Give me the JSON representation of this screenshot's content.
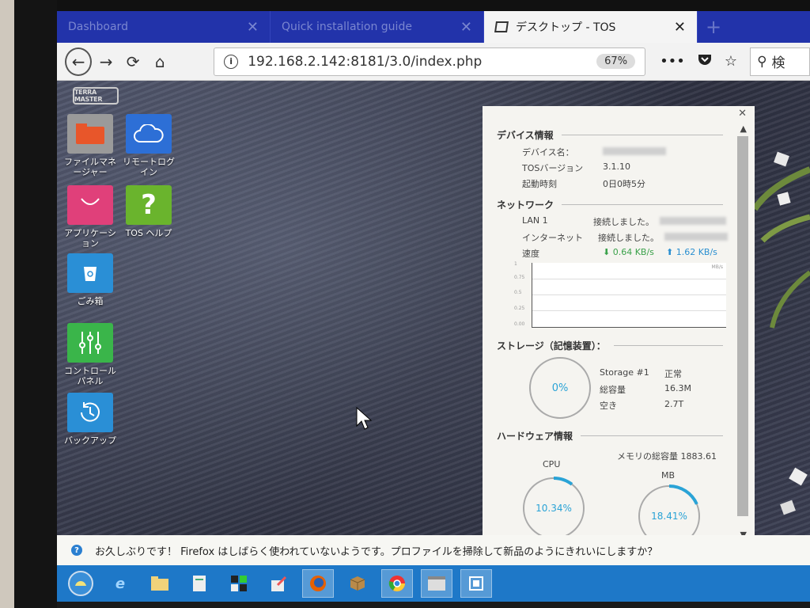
{
  "browser": {
    "tabs": [
      {
        "label": "Dashboard",
        "active": false
      },
      {
        "label": "Quick installation guide",
        "active": false
      },
      {
        "label": "デスクトップ - TOS",
        "active": true
      }
    ],
    "new_tab_icon": "plus-icon",
    "url": "192.168.2.142:8181/3.0/index.php",
    "zoom": "67%",
    "search_placeholder": "検"
  },
  "desktop": {
    "logo": "TERRA MASTER",
    "icons": [
      {
        "label": "ファイルマネージャー",
        "icon": "folder-icon",
        "color": "#e8562a"
      },
      {
        "label": "リモートログイン",
        "icon": "cloud-icon",
        "color": "#2d6fd6"
      },
      {
        "label": "アプリケーション",
        "icon": "bag-icon",
        "color": "#e0407a"
      },
      {
        "label": "TOS ヘルプ",
        "icon": "help-icon",
        "color": "#6ab42d"
      },
      {
        "label": "ごみ箱",
        "icon": "trash-icon",
        "color": "#2a8fd6"
      },
      {
        "label": "コントロールパネル",
        "icon": "sliders-icon",
        "color": "#3ab54a"
      },
      {
        "label": "バックアップ",
        "icon": "backup-clock-icon",
        "color": "#2a8fd6"
      }
    ]
  },
  "panel": {
    "device": {
      "heading": "デバイス情報",
      "name_label": "デバイス名：",
      "tos_label": "TOSバージョン",
      "tos_value": "3.1.10",
      "uptime_label": "起動時刻",
      "uptime_value": "0日0時5分"
    },
    "network": {
      "heading": "ネットワーク",
      "lan_label": "LAN 1",
      "lan_status": "接続しました。",
      "inet_label": "インターネット",
      "inet_status": "接続しました。",
      "speed_label": "速度",
      "down": "0.64 KB/s",
      "up": "1.62 KB/s",
      "graph_unit": "MB/s",
      "graph_ticks": [
        "1",
        "0.75",
        "0.5",
        "0.25",
        "0.00"
      ]
    },
    "storage": {
      "heading": "ストレージ（記憶装置）：",
      "usage_percent": "0%",
      "usage_fraction": 0,
      "name": "Storage #1",
      "status": "正常",
      "total_label": "総容量",
      "total_value": "16.3M",
      "free_label": "空き",
      "free_value": "2.7T"
    },
    "hardware": {
      "heading": "ハードウェア情報",
      "cpu_label": "CPU",
      "cpu_percent": "10.34%",
      "cpu_fraction": 0.1034,
      "mem_label": "メモリの総容量 1883.61",
      "mem_unit": "MB",
      "mem_percent": "18.41%",
      "mem_fraction": 0.1841
    }
  },
  "notification": {
    "text": "お久しぶりです！ Firefox はしばらく使われていないようです。プロファイルを掃除して新品のようにきれいにしますか？"
  },
  "colors": {
    "tabstrip": "#2233aa",
    "taskbar": "#1e78c8",
    "ring_accent": "#2aa3d6"
  }
}
